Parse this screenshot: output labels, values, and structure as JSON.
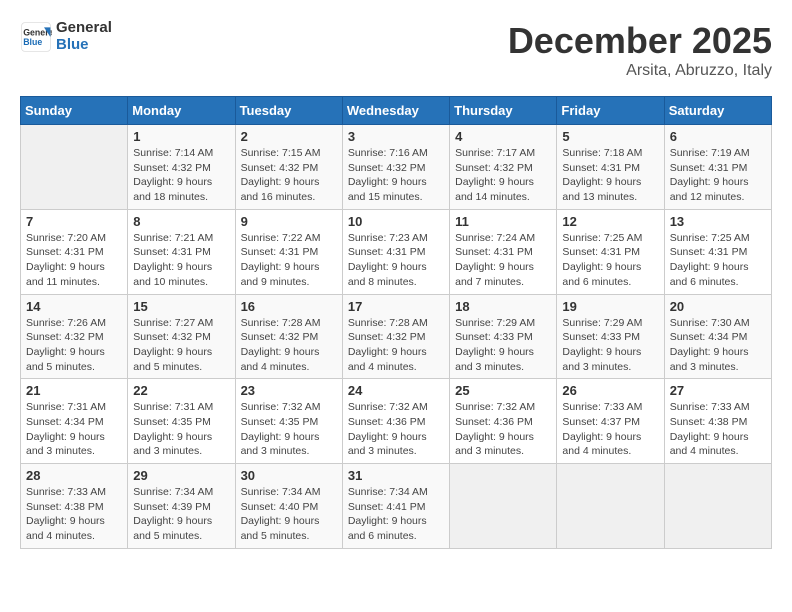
{
  "header": {
    "logo_line1": "General",
    "logo_line2": "Blue",
    "month": "December 2025",
    "location": "Arsita, Abruzzo, Italy"
  },
  "weekdays": [
    "Sunday",
    "Monday",
    "Tuesday",
    "Wednesday",
    "Thursday",
    "Friday",
    "Saturday"
  ],
  "weeks": [
    [
      {
        "day": "",
        "sunrise": "",
        "sunset": "",
        "daylight": ""
      },
      {
        "day": "1",
        "sunrise": "7:14 AM",
        "sunset": "4:32 PM",
        "daylight": "9 hours and 18 minutes."
      },
      {
        "day": "2",
        "sunrise": "7:15 AM",
        "sunset": "4:32 PM",
        "daylight": "9 hours and 16 minutes."
      },
      {
        "day": "3",
        "sunrise": "7:16 AM",
        "sunset": "4:32 PM",
        "daylight": "9 hours and 15 minutes."
      },
      {
        "day": "4",
        "sunrise": "7:17 AM",
        "sunset": "4:32 PM",
        "daylight": "9 hours and 14 minutes."
      },
      {
        "day": "5",
        "sunrise": "7:18 AM",
        "sunset": "4:31 PM",
        "daylight": "9 hours and 13 minutes."
      },
      {
        "day": "6",
        "sunrise": "7:19 AM",
        "sunset": "4:31 PM",
        "daylight": "9 hours and 12 minutes."
      }
    ],
    [
      {
        "day": "7",
        "sunrise": "7:20 AM",
        "sunset": "4:31 PM",
        "daylight": "9 hours and 11 minutes."
      },
      {
        "day": "8",
        "sunrise": "7:21 AM",
        "sunset": "4:31 PM",
        "daylight": "9 hours and 10 minutes."
      },
      {
        "day": "9",
        "sunrise": "7:22 AM",
        "sunset": "4:31 PM",
        "daylight": "9 hours and 9 minutes."
      },
      {
        "day": "10",
        "sunrise": "7:23 AM",
        "sunset": "4:31 PM",
        "daylight": "9 hours and 8 minutes."
      },
      {
        "day": "11",
        "sunrise": "7:24 AM",
        "sunset": "4:31 PM",
        "daylight": "9 hours and 7 minutes."
      },
      {
        "day": "12",
        "sunrise": "7:25 AM",
        "sunset": "4:31 PM",
        "daylight": "9 hours and 6 minutes."
      },
      {
        "day": "13",
        "sunrise": "7:25 AM",
        "sunset": "4:31 PM",
        "daylight": "9 hours and 6 minutes."
      }
    ],
    [
      {
        "day": "14",
        "sunrise": "7:26 AM",
        "sunset": "4:32 PM",
        "daylight": "9 hours and 5 minutes."
      },
      {
        "day": "15",
        "sunrise": "7:27 AM",
        "sunset": "4:32 PM",
        "daylight": "9 hours and 5 minutes."
      },
      {
        "day": "16",
        "sunrise": "7:28 AM",
        "sunset": "4:32 PM",
        "daylight": "9 hours and 4 minutes."
      },
      {
        "day": "17",
        "sunrise": "7:28 AM",
        "sunset": "4:32 PM",
        "daylight": "9 hours and 4 minutes."
      },
      {
        "day": "18",
        "sunrise": "7:29 AM",
        "sunset": "4:33 PM",
        "daylight": "9 hours and 3 minutes."
      },
      {
        "day": "19",
        "sunrise": "7:29 AM",
        "sunset": "4:33 PM",
        "daylight": "9 hours and 3 minutes."
      },
      {
        "day": "20",
        "sunrise": "7:30 AM",
        "sunset": "4:34 PM",
        "daylight": "9 hours and 3 minutes."
      }
    ],
    [
      {
        "day": "21",
        "sunrise": "7:31 AM",
        "sunset": "4:34 PM",
        "daylight": "9 hours and 3 minutes."
      },
      {
        "day": "22",
        "sunrise": "7:31 AM",
        "sunset": "4:35 PM",
        "daylight": "9 hours and 3 minutes."
      },
      {
        "day": "23",
        "sunrise": "7:32 AM",
        "sunset": "4:35 PM",
        "daylight": "9 hours and 3 minutes."
      },
      {
        "day": "24",
        "sunrise": "7:32 AM",
        "sunset": "4:36 PM",
        "daylight": "9 hours and 3 minutes."
      },
      {
        "day": "25",
        "sunrise": "7:32 AM",
        "sunset": "4:36 PM",
        "daylight": "9 hours and 3 minutes."
      },
      {
        "day": "26",
        "sunrise": "7:33 AM",
        "sunset": "4:37 PM",
        "daylight": "9 hours and 4 minutes."
      },
      {
        "day": "27",
        "sunrise": "7:33 AM",
        "sunset": "4:38 PM",
        "daylight": "9 hours and 4 minutes."
      }
    ],
    [
      {
        "day": "28",
        "sunrise": "7:33 AM",
        "sunset": "4:38 PM",
        "daylight": "9 hours and 4 minutes."
      },
      {
        "day": "29",
        "sunrise": "7:34 AM",
        "sunset": "4:39 PM",
        "daylight": "9 hours and 5 minutes."
      },
      {
        "day": "30",
        "sunrise": "7:34 AM",
        "sunset": "4:40 PM",
        "daylight": "9 hours and 5 minutes."
      },
      {
        "day": "31",
        "sunrise": "7:34 AM",
        "sunset": "4:41 PM",
        "daylight": "9 hours and 6 minutes."
      },
      {
        "day": "",
        "sunrise": "",
        "sunset": "",
        "daylight": ""
      },
      {
        "day": "",
        "sunrise": "",
        "sunset": "",
        "daylight": ""
      },
      {
        "day": "",
        "sunrise": "",
        "sunset": "",
        "daylight": ""
      }
    ]
  ]
}
